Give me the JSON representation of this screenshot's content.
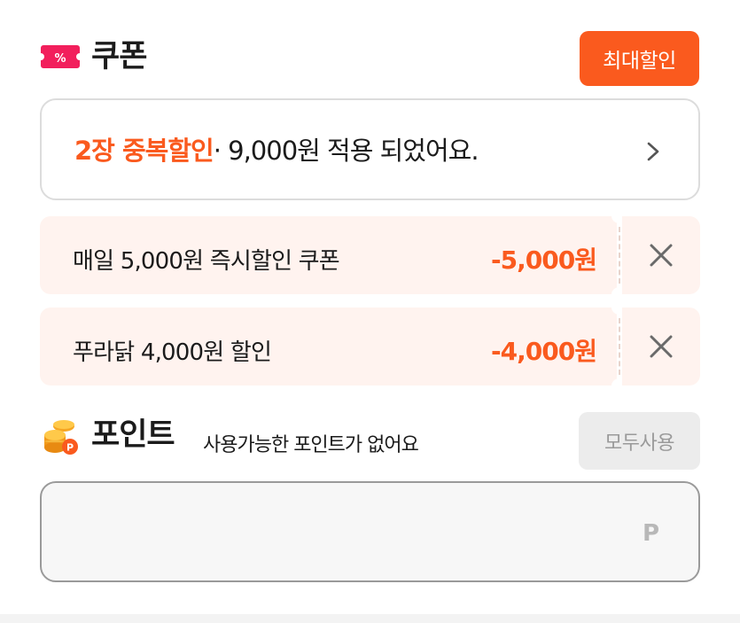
{
  "coupon": {
    "title": "쿠폰",
    "icon": "coupon-ticket-icon",
    "max_discount_label": "최대할인",
    "summary": {
      "highlight": "2장 중복할인",
      "rest": "· 9,000원 적용 되었어요."
    },
    "items": [
      {
        "name": "매일 5,000원 즉시할인 쿠폰",
        "amount": "-5,000원"
      },
      {
        "name": "푸라닭 4,000원 할인",
        "amount": "-4,000원"
      }
    ]
  },
  "points": {
    "title": "포인트",
    "icon": "coin-stack-icon",
    "subtitle": "사용가능한 포인트가 없어요",
    "use_all_label": "모두사용",
    "unit": "P",
    "value": ""
  },
  "colors": {
    "accent": "#fa5a1e",
    "coupon_bg": "#fff3ef",
    "disabled_bg": "#ececec",
    "disabled_text": "#9a9a9a"
  }
}
